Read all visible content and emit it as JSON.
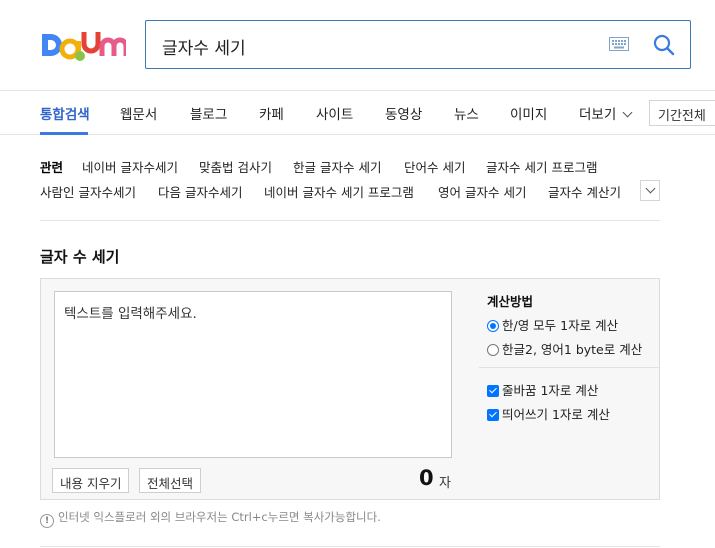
{
  "brand": {
    "logo_text": "Daum",
    "colors": {
      "d": "#4285f4",
      "a": "#f2b10a",
      "u": "#e34234",
      "u2": "#8bc34a",
      "m": "#e75a8a"
    }
  },
  "search": {
    "query": "글자수 세기",
    "keyboard_icon": "keyboard-icon",
    "search_icon": "search-icon"
  },
  "nav": {
    "tabs": [
      {
        "label": "통합검색",
        "active": true
      },
      {
        "label": "웹문서"
      },
      {
        "label": "블로그"
      },
      {
        "label": "카페"
      },
      {
        "label": "사이트"
      },
      {
        "label": "동영상"
      },
      {
        "label": "뉴스"
      },
      {
        "label": "이미지"
      },
      {
        "label": "더보기"
      }
    ],
    "period": "기간전체"
  },
  "related": {
    "title": "관련",
    "row1": [
      "네이버 글자수세기",
      "맞춤법 검사기",
      "한글 글자수 세기",
      "단어수 세기",
      "글자수 세기 프로그램"
    ],
    "row2": [
      "사람인 글자수세기",
      "다음 글자수세기",
      "네이버 글자수 세기 프로그램",
      "영어 글자수 세기",
      "글자수 계산기"
    ]
  },
  "tool": {
    "title": "글자 수 세기",
    "placeholder": "텍스트를 입력해주세요.",
    "clear_label": "내용 지우기",
    "select_all_label": "전체선택",
    "count": "0",
    "count_unit": "자",
    "method_title": "계산방법",
    "methods": [
      {
        "label": "한/영 모두 1자로 계산",
        "selected": true
      },
      {
        "label": "한글2, 영어1 byte로 계산",
        "selected": false
      }
    ],
    "options": [
      {
        "label": "줄바꿈 1자로 계산",
        "checked": true
      },
      {
        "label": "띄어쓰기 1자로 계산",
        "checked": true
      }
    ]
  },
  "notice": "인터넷 익스플로러 외의 브라우저는 Ctrl+c누르면 복사가능합니다."
}
